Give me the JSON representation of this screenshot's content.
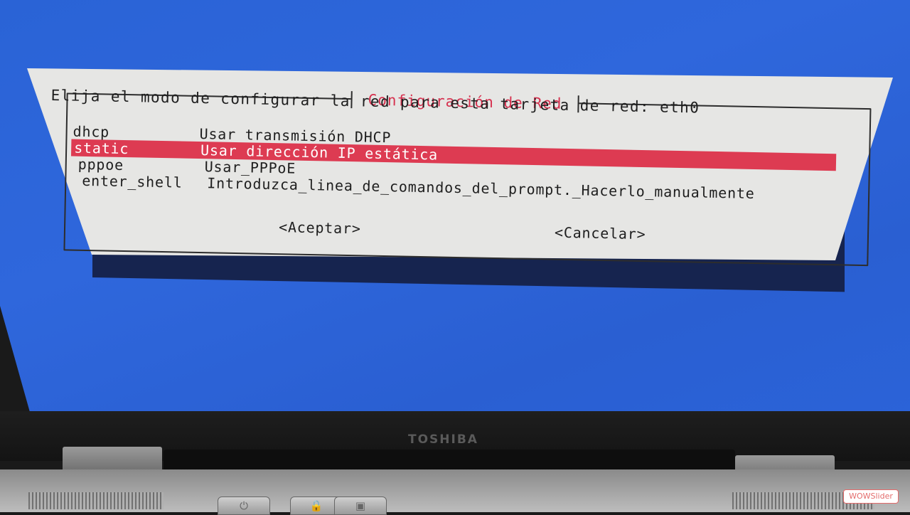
{
  "dialog": {
    "title": "Configuración de Red",
    "prompt": "Elija el modo de configurar la red para esta tarjeta de red: eth0",
    "options": [
      {
        "key": "dhcp",
        "label": "Usar transmisión DHCP",
        "selected": false
      },
      {
        "key": "static",
        "label": "Usar dirección IP estática",
        "selected": true
      },
      {
        "key": "pppoe",
        "label": "Usar_PPPoE",
        "selected": false
      },
      {
        "key": "enter_shell",
        "label": "Introduzca_linea_de_comandos_del_prompt._Hacerlo_manualmente",
        "selected": false
      }
    ],
    "accept_label": "<Aceptar>",
    "cancel_label": "<Cancelar>"
  },
  "laptop": {
    "brand": "TOSHIBA"
  },
  "watermark": "WOWSlider",
  "colors": {
    "screen_bg": "#2f67dc",
    "dialog_bg": "#e6e6e4",
    "accent": "#dd3b52",
    "title": "#d6304e"
  },
  "icons": [
    "power-icon",
    "lock-icon",
    "media-icon"
  ]
}
